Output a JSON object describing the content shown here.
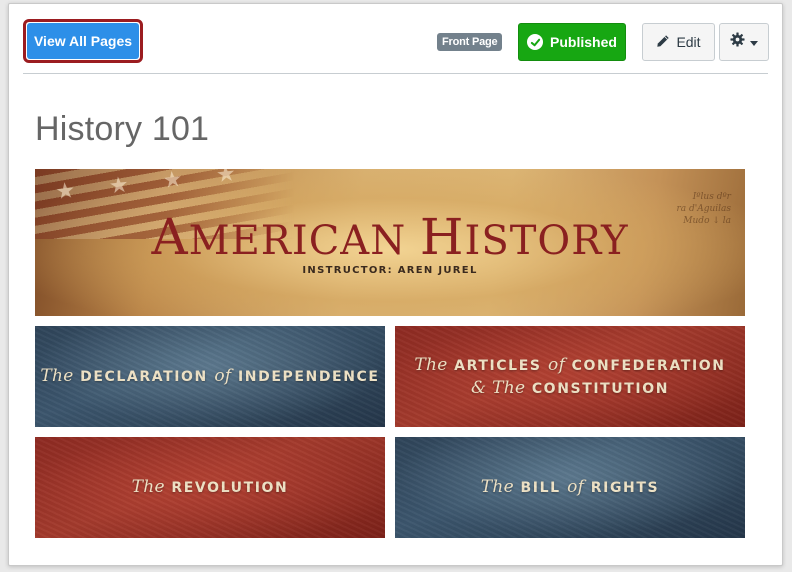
{
  "toolbar": {
    "view_all_label": "View All Pages",
    "front_page_badge": "Front Page",
    "published_label": "Published",
    "edit_label": "Edit"
  },
  "page": {
    "title": "History 101"
  },
  "banner": {
    "title": "American History",
    "title_parts": {
      "a1": "A",
      "a2": "MERICAN ",
      "h1": "H",
      "h2": "ISTORY"
    },
    "instructor": "INSTRUCTOR: AREN JUREL"
  },
  "tiles": [
    {
      "pre": "The",
      "main": "DECLARATION",
      "mid": "of",
      "end": "INDEPENDENCE",
      "theme": "blue"
    },
    {
      "line1_pre": "The",
      "line1_main": "ARTICLES",
      "line1_mid": "of",
      "line1_end": "CONFEDERATION",
      "line2_pre": "& The",
      "line2_main": "CONSTITUTION",
      "theme": "red"
    },
    {
      "pre": "The",
      "main": "REVOLUTION",
      "theme": "red"
    },
    {
      "pre": "The",
      "main": "BILL",
      "mid": "of",
      "end": "RIGHTS",
      "theme": "blue"
    }
  ],
  "colors": {
    "primary_button": "#2d8fe8",
    "published_green": "#17a712",
    "highlight_border": "#9b1c20",
    "badge_gray": "#73818c"
  },
  "icons": [
    "check-circle-icon",
    "pencil-icon",
    "gear-icon",
    "caret-down-icon"
  ]
}
